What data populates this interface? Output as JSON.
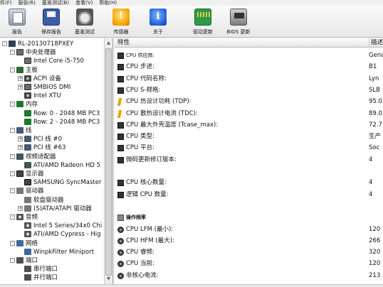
{
  "menubar": [
    "件(F)",
    "报告(R)",
    "基准测试(B)",
    "查看(V)",
    "帮助(H)"
  ],
  "toolbar": {
    "buttons": [
      {
        "label": "报告",
        "icon": "report-icon"
      },
      {
        "label": "保存报告",
        "icon": "save-icon"
      },
      {
        "label": "基准测试",
        "icon": "benchmark-icon"
      },
      {
        "label": "传感器",
        "icon": "sensor-icon"
      },
      {
        "label": "关于",
        "icon": "info-icon"
      },
      {
        "label": "驱动更新",
        "icon": "driver-update-icon"
      },
      {
        "label": "BIOS 更新",
        "icon": "bios-update-icon"
      }
    ]
  },
  "tree": [
    {
      "label": "RL-20130718PXEY",
      "expander": "-",
      "icon": "computer-icon"
    },
    {
      "label": "中央处理器",
      "expander": "-",
      "icon": "cpu-icon"
    },
    {
      "label": "Intel Core i5-750",
      "expander": "",
      "icon": "cpu-icon"
    },
    {
      "label": "主板",
      "expander": "-",
      "icon": "motherboard-icon"
    },
    {
      "label": "ACPI 设备",
      "expander": "+",
      "icon": "gear-icon"
    },
    {
      "label": "SMBIOS DMI",
      "expander": "+",
      "icon": "chip-icon"
    },
    {
      "label": "Intel XTU",
      "expander": "",
      "icon": "disc-icon"
    },
    {
      "label": "内存",
      "expander": "-",
      "icon": "memory-icon"
    },
    {
      "label": "Row: 0 - 2048 MB PC3",
      "expander": "",
      "icon": "memory-icon"
    },
    {
      "label": "Row: 2 - 2048 MB PC3",
      "expander": "",
      "icon": "memory-icon"
    },
    {
      "label": "线",
      "expander": "-",
      "icon": "bus-icon"
    },
    {
      "label": "PCI 线 #0",
      "expander": "+",
      "icon": "bus-icon"
    },
    {
      "label": "PCI 线 #63",
      "expander": "+",
      "icon": "bus-icon"
    },
    {
      "label": "视频适配器",
      "expander": "-",
      "icon": "gpu-icon"
    },
    {
      "label": "ATI/AMD Radeon HD 5",
      "expander": "",
      "icon": "gpu-icon"
    },
    {
      "label": "显示器",
      "expander": "-",
      "icon": "monitor-icon"
    },
    {
      "label": "SAMSUNG SyncMaster",
      "expander": "",
      "icon": "monitor-icon"
    },
    {
      "label": "驱动器",
      "expander": "-",
      "icon": "drive-icon"
    },
    {
      "label": "软盘驱动器",
      "expander": "",
      "icon": "drive-icon"
    },
    {
      "label": "(S)ATA/ATAPI 驱动器",
      "expander": "+",
      "icon": "drive-icon"
    },
    {
      "label": "音频",
      "expander": "-",
      "icon": "audio-icon"
    },
    {
      "label": "Intel 5 Series/34x0 Chi",
      "expander": "",
      "icon": "audio-icon"
    },
    {
      "label": "ATI/AMD Cypress - Hig",
      "expander": "",
      "icon": "audio-icon"
    },
    {
      "label": "网络",
      "expander": "-",
      "icon": "network-icon"
    },
    {
      "label": "WinpkFilter Miniport",
      "expander": "",
      "icon": "network-icon"
    },
    {
      "label": "端口",
      "expander": "-",
      "icon": "port-icon"
    },
    {
      "label": "串行端口",
      "expander": "",
      "icon": "port-icon"
    },
    {
      "label": "并行端口",
      "expander": "",
      "icon": "port-icon"
    }
  ],
  "detail": {
    "col_feature": "特性",
    "col_desc": "描述",
    "rows": [
      {
        "key": "CPU 供应商:",
        "value": "Genu",
        "icon": "chip-icon",
        "small": true
      },
      {
        "key": "CPU 步进:",
        "value": "B1",
        "icon": "chip-icon"
      },
      {
        "key": "CPU 代码名称:",
        "value": "Lyn",
        "icon": "chip-icon"
      },
      {
        "key": "CPU S-规格:",
        "value": "SLB",
        "icon": "chip-icon"
      },
      {
        "key": "CPU 热设计功耗 (TDP):",
        "value": "95.0",
        "icon": "bolt-icon"
      },
      {
        "key": "CPU 散热设计电流 (TDC):",
        "value": "89.0",
        "icon": "bolt-icon"
      },
      {
        "key": "CPU 最大外壳温度 (Tcase_max):",
        "value": "72.7",
        "icon": "chip-icon"
      },
      {
        "key": "CPU 类型:",
        "value": "生产",
        "icon": "chip-icon"
      },
      {
        "key": "CPU 平台:",
        "value": "Soc",
        "icon": "chip-icon"
      },
      {
        "key": "微码更新修订版本:",
        "value": "4",
        "icon": "chip-icon"
      },
      {
        "key": "",
        "value": "",
        "icon": ""
      },
      {
        "key": "CPU 核心数量:",
        "value": "4",
        "icon": "chip-icon"
      },
      {
        "key": "逻辑 CPU 数量:",
        "value": "4",
        "icon": "chip-icon"
      },
      {
        "key": "",
        "value": "",
        "icon": ""
      },
      {
        "key": "操作频率",
        "value": "",
        "icon": "section-icon",
        "section": true
      },
      {
        "key": "CPU LFM (最小):",
        "value": "120",
        "icon": "gauge-icon"
      },
      {
        "key": "CPU HFM (最大):",
        "value": "266",
        "icon": "gauge-icon"
      },
      {
        "key": "CPU 睿频:",
        "value": "320",
        "icon": "gauge-icon"
      },
      {
        "key": "CPU 当前:",
        "value": "120",
        "icon": "gauge-icon"
      },
      {
        "key": "非核心电流:",
        "value": "213",
        "icon": "gauge-icon"
      }
    ]
  }
}
